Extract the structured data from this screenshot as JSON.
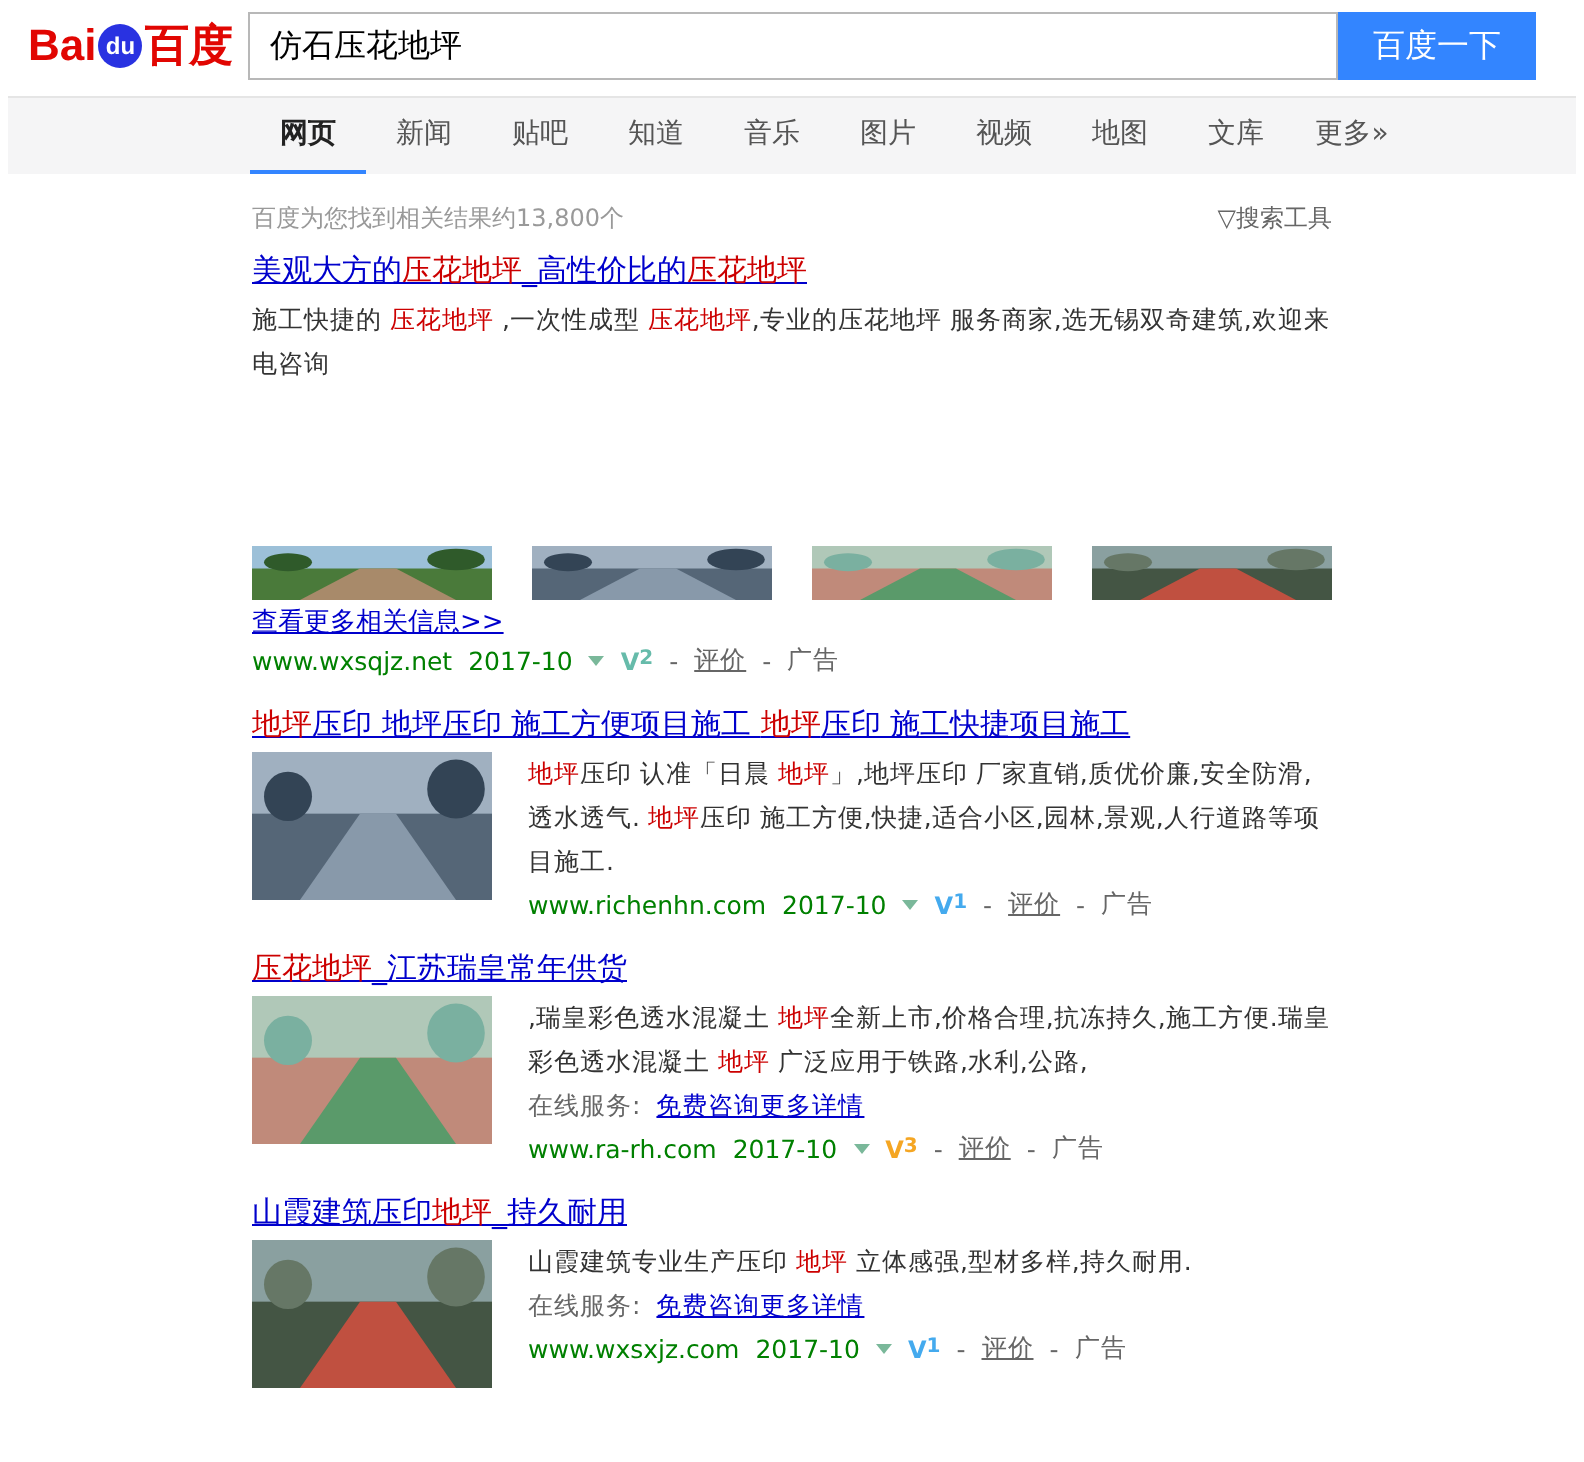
{
  "logo": {
    "left": "Bai",
    "paw": "du",
    "right": "百度"
  },
  "search": {
    "value": "仿石压花地坪",
    "button": "百度一下"
  },
  "tabs": [
    {
      "label": "网页",
      "selected": true
    },
    {
      "label": "新闻",
      "selected": false
    },
    {
      "label": "贴吧",
      "selected": false
    },
    {
      "label": "知道",
      "selected": false
    },
    {
      "label": "音乐",
      "selected": false
    },
    {
      "label": "图片",
      "selected": false
    },
    {
      "label": "视频",
      "selected": false
    },
    {
      "label": "地图",
      "selected": false
    },
    {
      "label": "文库",
      "selected": false
    },
    {
      "label": "更多»",
      "selected": false
    }
  ],
  "result_count": "百度为您找到相关结果约13,800个",
  "tools": "搜索工具",
  "tools_icon": "▽",
  "results": [
    {
      "kind": "gallery",
      "title": [
        {
          "text": "美观大方的",
          "hl": false
        },
        {
          "text": "压花地坪",
          "hl": true
        },
        {
          "text": "_高性价比的",
          "hl": false
        },
        {
          "text": "压花地坪",
          "hl": true
        }
      ],
      "snippet": [
        {
          "text": "施工快捷的 ",
          "hl": false
        },
        {
          "text": "压花地坪",
          "hl": true
        },
        {
          "text": " ,一次性成型 ",
          "hl": false
        },
        {
          "text": "压花地坪",
          "hl": true
        },
        {
          "text": ",专业的压花地坪 服务商家,选无锡双奇建筑,欢迎来电咨询",
          "hl": false
        }
      ],
      "pictures": [
        {
          "kind": "picture"
        },
        {
          "kind": "picture"
        },
        {
          "kind": "picture"
        },
        {
          "kind": "picture"
        }
      ],
      "more": "查看更多相关信息>>",
      "url": "www.wxsqjz.net",
      "date": "2017-10",
      "badge": "V",
      "badge_level": "2",
      "color": "#66bbaa",
      "sep": "-",
      "review": "评价",
      "ad": "广告"
    },
    {
      "title": [
        {
          "text": "地坪",
          "hl": true
        },
        {
          "text": "压印 地坪压印 施工方便项目施工 ",
          "hl": false
        },
        {
          "text": "地坪",
          "hl": true
        },
        {
          "text": "压印 施工快捷项目施工",
          "hl": false
        }
      ],
      "snippet": [
        {
          "text": "地坪",
          "hl": true
        },
        {
          "text": "压印 认准「日晨 ",
          "hl": false
        },
        {
          "text": "地坪",
          "hl": true
        },
        {
          "text": "」,地坪压印 厂家直销,质优价廉,安全防滑,透水透气. ",
          "hl": false
        },
        {
          "text": "地坪",
          "hl": true
        },
        {
          "text": "压印 施工方便,快捷,适合小区,园林,景观,人行道路等项目施工.",
          "hl": false
        }
      ],
      "picture": {
        "kind": "picture"
      },
      "url": "www.richenhn.com",
      "date": "2017-10",
      "badge": "V",
      "badge_level": "1",
      "color": "#44aaee",
      "sep": "-",
      "review": "评价",
      "ad": "广告"
    },
    {
      "title": [
        {
          "text": "压花地坪",
          "hl": true
        },
        {
          "text": "_江苏瑞皇常年供货",
          "hl": false
        }
      ],
      "snippet": [
        {
          "text": ",瑞皇彩色透水混凝土 ",
          "hl": false
        },
        {
          "text": "地坪",
          "hl": true
        },
        {
          "text": "全新上市,价格合理,抗冻持久,施工方便.瑞皇彩色透水混凝土 ",
          "hl": false
        },
        {
          "text": "地坪",
          "hl": true
        },
        {
          "text": " 广泛应用于铁路,水利,公路,",
          "hl": false
        }
      ],
      "picture": {
        "kind": "picture"
      },
      "service_label": "在线服务:",
      "service_link": "免费咨询更多详情",
      "url": "www.ra-rh.com",
      "date": "2017-10",
      "badge": "V",
      "badge_level": "3",
      "color": "#f5a623",
      "sep": "-",
      "review": "评价",
      "ad": "广告"
    },
    {
      "title": [
        {
          "text": "山霞建筑压印",
          "hl": false
        },
        {
          "text": "地坪",
          "hl": true
        },
        {
          "text": "_持久耐用",
          "hl": false
        }
      ],
      "snippet": [
        {
          "text": "山霞建筑专业生产压印 ",
          "hl": false
        },
        {
          "text": "地坪",
          "hl": true
        },
        {
          "text": " 立体感强,型材多样,持久耐用.",
          "hl": false
        }
      ],
      "picture": {
        "kind": "picture"
      },
      "service_label": "在线服务:",
      "service_link": "免费咨询更多详情",
      "url": "www.wxsxjz.com",
      "date": "2017-10",
      "badge": "V",
      "badge_level": "1",
      "color": "#44aaee",
      "sep": "-",
      "review": "评价",
      "ad": "广告"
    }
  ]
}
